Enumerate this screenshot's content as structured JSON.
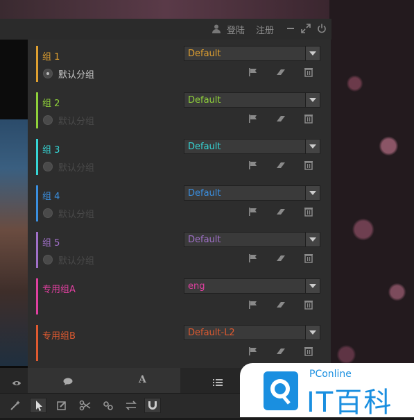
{
  "titlebar": {
    "login": "登陆",
    "register": "注册"
  },
  "groups": [
    {
      "name": "组 1",
      "color": "#e0a030",
      "default": "默认分组",
      "default_color": "#c8c8c8",
      "radio_on": true,
      "select": "Default"
    },
    {
      "name": "组 2",
      "color": "#8fd13a",
      "default": "默认分组",
      "default_color": "#4a4a4a",
      "radio_on": false,
      "select": "Default"
    },
    {
      "name": "组 3",
      "color": "#36d6d6",
      "default": "默认分组",
      "default_color": "#4a4a4a",
      "radio_on": false,
      "select": "Default"
    },
    {
      "name": "组 4",
      "color": "#3a8fe0",
      "default": "默认分组",
      "default_color": "#4a4a4a",
      "radio_on": false,
      "select": "Default"
    },
    {
      "name": "组 5",
      "color": "#a070c8",
      "default": "默认分组",
      "default_color": "#4a4a4a",
      "radio_on": false,
      "select": "Default"
    },
    {
      "name": "专用组A",
      "color": "#e040a0",
      "default": "",
      "default_color": "#4a4a4a",
      "radio_on": false,
      "select": "eng"
    },
    {
      "name": "专用组B",
      "color": "#e05a30",
      "default": "",
      "default_color": "#4a4a4a",
      "radio_on": false,
      "select": "Default-L2"
    }
  ],
  "icons": {
    "titlebar": [
      "user-icon",
      "minimize-icon",
      "expand-icon",
      "power-icon"
    ],
    "group_actions": [
      "flag-icon",
      "eraser-icon",
      "trash-icon"
    ],
    "tabs": [
      "eye-icon",
      "chat-icon",
      "font-icon",
      "list-icon"
    ],
    "tools": [
      "magic-wand-icon",
      "pointer-icon",
      "edit-icon",
      "scissors-icon",
      "link-icon",
      "swap-icon",
      "magnet-icon"
    ]
  },
  "brand": {
    "pconline": "PConline",
    "itbaike": "IT百科"
  }
}
